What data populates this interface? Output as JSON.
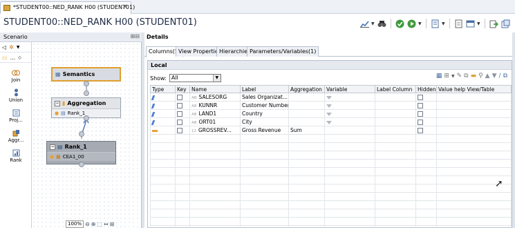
{
  "tab": {
    "title": "*STUDENT00::NED_RANK H00 (STUDENT01)",
    "close": "✕"
  },
  "editor": {
    "title": "STUDENT00::NED_RANK H00 (STUDENT01)"
  },
  "scenario": {
    "title": "Scenario",
    "palette": [
      "Join",
      "Union",
      "Proj...",
      "Aggr...",
      "Rank"
    ],
    "nodes": {
      "semantics": "Semantics",
      "aggregation": "Aggregation",
      "aggregation_input": "Rank_1",
      "rank": "Rank_1",
      "rank_input": "CEA1_00"
    },
    "zoom": "100%"
  },
  "details": {
    "title": "Details",
    "tabs": [
      "Columns(5)",
      "View Properties",
      "Hierarchies",
      "Parameters/Variables(1)"
    ],
    "local_title": "Local",
    "show_label": "Show:",
    "show_value": "All",
    "columns": [
      "Type",
      "Key",
      "Name",
      "Label",
      "Aggregation",
      "Variable",
      "Label Column",
      "Hidden",
      "Value help View/Table"
    ],
    "rows": [
      {
        "type": "attribute",
        "dtype": "AB",
        "name": "SALESORG",
        "label": "Sales Organizat...",
        "aggregation": "",
        "variable": true
      },
      {
        "type": "attribute",
        "dtype": "AB",
        "name": "KUNNR",
        "label": "Customer Number",
        "aggregation": "",
        "variable": true
      },
      {
        "type": "attribute",
        "dtype": "AB",
        "name": "LAND1",
        "label": "Country",
        "aggregation": "",
        "variable": true
      },
      {
        "type": "attribute",
        "dtype": "AB",
        "name": "ORT01",
        "label": "City",
        "aggregation": "",
        "variable": true
      },
      {
        "type": "measure",
        "dtype": "12",
        "name": "GROSSREV...",
        "label": "Gross Revenue",
        "aggregation": "Sum",
        "variable": false
      }
    ]
  }
}
